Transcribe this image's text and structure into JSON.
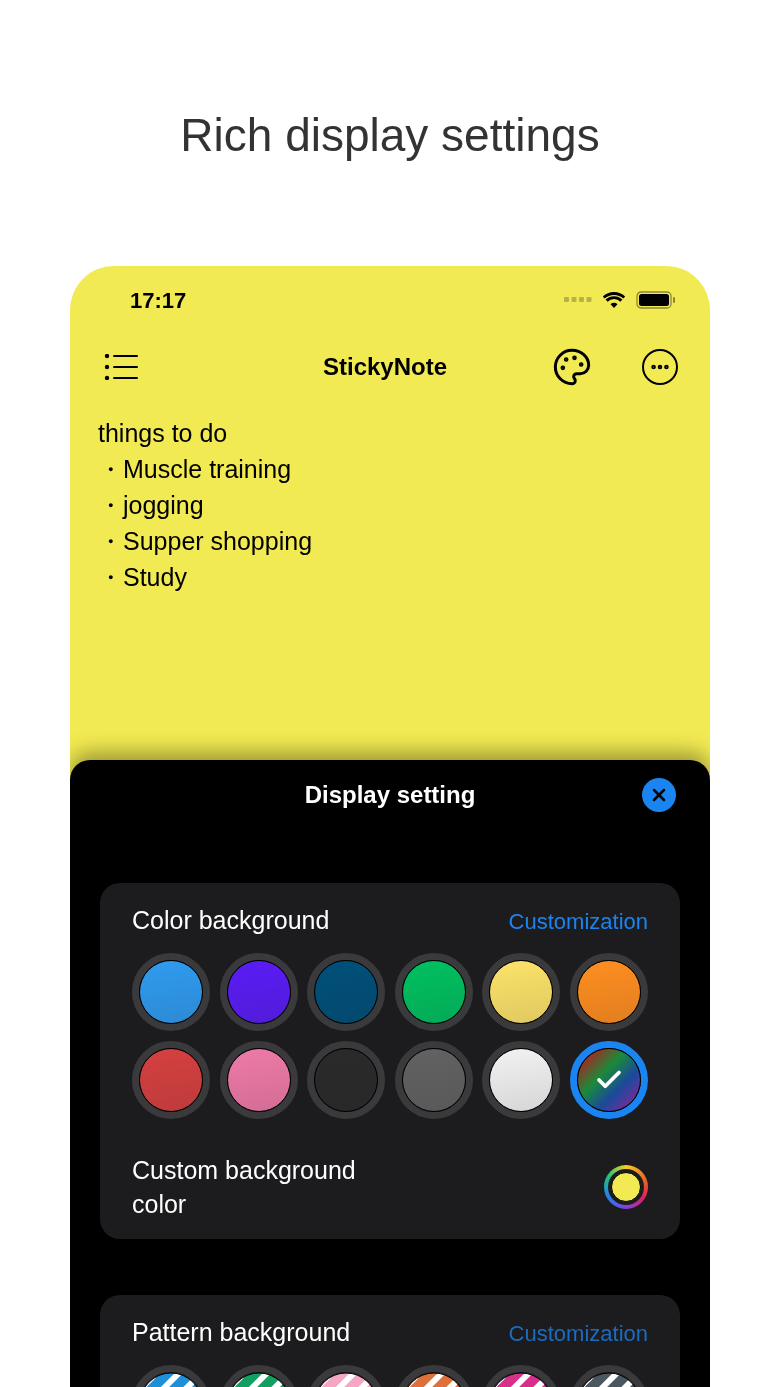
{
  "headline": "Rich display settings",
  "status_bar": {
    "time": "17:17"
  },
  "nav": {
    "title": "StickyNote"
  },
  "note": {
    "lines": [
      "things to do",
      "・Muscle training",
      "・jogging",
      "・Supper shopping",
      "・Study"
    ]
  },
  "sheet": {
    "title": "Display setting",
    "color_section": {
      "title": "Color background",
      "link": "Customization",
      "swatches": [
        {
          "kind": "solid",
          "color": "#2f9bf0",
          "selected": false
        },
        {
          "kind": "solid",
          "color": "#5a1cf5",
          "selected": false
        },
        {
          "kind": "solid",
          "color": "#00507a",
          "selected": false
        },
        {
          "kind": "solid",
          "color": "#00c060",
          "selected": false
        },
        {
          "kind": "solid",
          "color": "#fde36a",
          "selected": false
        },
        {
          "kind": "solid",
          "color": "#ff8e20",
          "selected": false
        },
        {
          "kind": "solid",
          "color": "#d64040",
          "selected": false
        },
        {
          "kind": "solid",
          "color": "#ee7aa8",
          "selected": false
        },
        {
          "kind": "solid",
          "color": "#2a2a2a",
          "selected": false
        },
        {
          "kind": "solid",
          "color": "#626262",
          "selected": false
        },
        {
          "kind": "solid",
          "color": "#f2f2f2",
          "selected": false
        },
        {
          "kind": "rainbow",
          "selected": true
        }
      ],
      "custom": {
        "label": "Custom background color",
        "color": "#f2ea52"
      }
    },
    "pattern_section": {
      "title": "Pattern background",
      "link": "Customization",
      "swatches": [
        {
          "color": "#1e90d8"
        },
        {
          "color": "#12a060"
        },
        {
          "color": "#f4a6c4"
        },
        {
          "color": "#e0703a"
        },
        {
          "color": "#d8308a"
        },
        {
          "color": "#4a5660"
        }
      ]
    }
  }
}
